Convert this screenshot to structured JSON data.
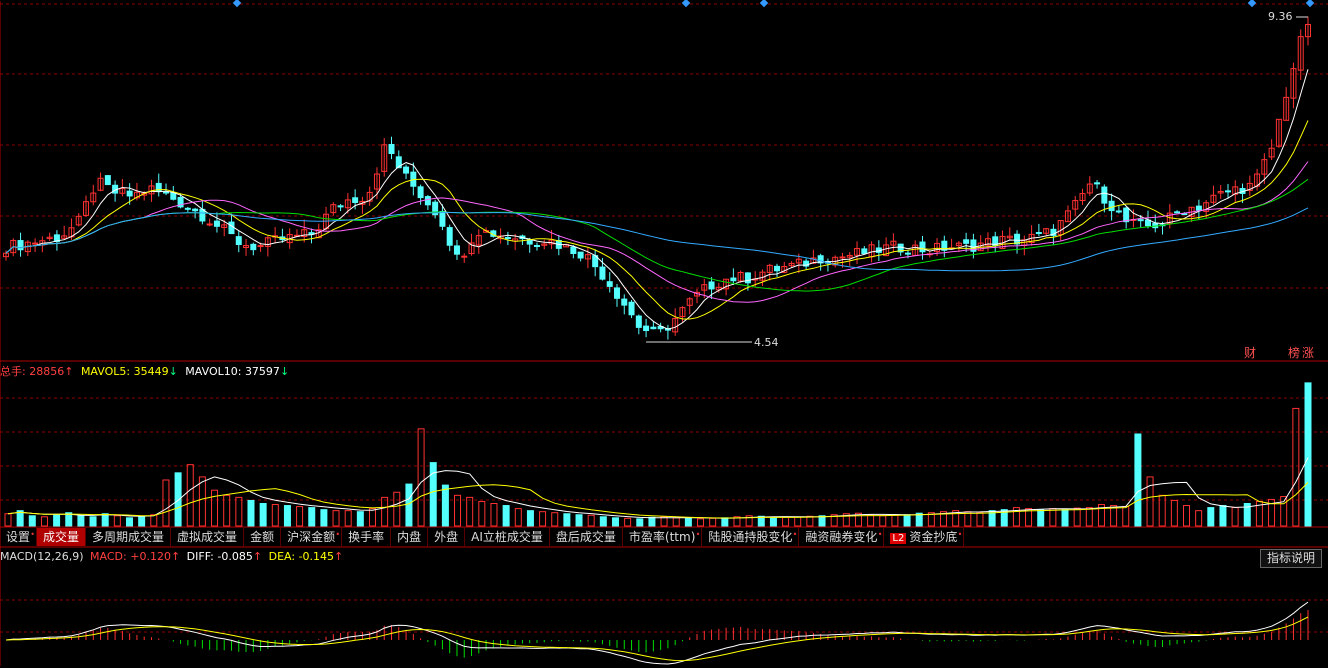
{
  "price_panel": {
    "high_label": "9.36",
    "low_label": "4.54",
    "badges": [
      "财",
      "榜",
      "涨"
    ]
  },
  "volume_panel": {
    "total_label": "总手:",
    "total_value": "28856",
    "total_arrow": "↑",
    "mavol5_label": "MAVOL5:",
    "mavol5_value": "35449",
    "mavol5_arrow": "↓",
    "mavol10_label": "MAVOL10:",
    "mavol10_value": "37597",
    "mavol10_arrow": "↓"
  },
  "tabs": [
    {
      "label": "设置",
      "dot": "•"
    },
    {
      "label": "成交量",
      "active": true
    },
    {
      "label": "多周期成交量"
    },
    {
      "label": "虚拟成交量"
    },
    {
      "label": "金额"
    },
    {
      "label": "沪深金额",
      "dot": "•"
    },
    {
      "label": "换手率"
    },
    {
      "label": "内盘"
    },
    {
      "label": "外盘"
    },
    {
      "label": "AI立桩成交量"
    },
    {
      "label": "盘后成交量"
    },
    {
      "label": "市盈率(ttm)",
      "dot": "•"
    },
    {
      "label": "陆股通持股变化",
      "dot": "•"
    },
    {
      "label": "融资融券变化",
      "dot": "•"
    },
    {
      "label": "资金抄底",
      "badge": "L2",
      "dot": "•"
    }
  ],
  "macd_panel": {
    "title": "MACD(12,26,9)",
    "macd_label": "MACD:",
    "macd_value": "+0.120",
    "macd_arrow": "↑",
    "diff_label": "DIFF:",
    "diff_value": "-0.085",
    "diff_arrow": "↑",
    "dea_label": "DEA:",
    "dea_value": "-0.145",
    "dea_arrow": "↑",
    "help_button": "指标说明"
  },
  "colors": {
    "up": "#ff3232",
    "down": "#54ffff",
    "grid": "#8b0000",
    "ma5": "#ffffff",
    "ma10": "#ffff00",
    "ma20": "#ff66ff",
    "ma30": "#00dd00",
    "ma60": "#33aaff",
    "diff": "#ffffff",
    "dea": "#ffff00",
    "macd_up": "#ff3232",
    "macd_down": "#00dd00",
    "marker": "#3399ff"
  },
  "chart_data": [
    {
      "type": "candlestick",
      "title": "",
      "ylim": [
        4.3,
        9.5
      ],
      "labeled_points": [
        {
          "label": "9.36",
          "value": 9.36
        },
        {
          "label": "4.54",
          "value": 4.54
        }
      ],
      "close_path": [
        5.95,
        6.0,
        6.05,
        6.1,
        6.3,
        6.9,
        6.75,
        6.7,
        6.8,
        6.7,
        6.55,
        6.4,
        6.2,
        6.0,
        5.95,
        6.05,
        6.1,
        6.15,
        6.5,
        6.65,
        6.7,
        7.45,
        7.0,
        6.7,
        6.4,
        5.75,
        6.2,
        6.15,
        6.1,
        6.05,
        6.05,
        5.95,
        5.85,
        5.55,
        5.2,
        4.8,
        4.65,
        4.9,
        5.2,
        5.4,
        5.5,
        5.5,
        5.6,
        5.65,
        5.7,
        5.8,
        5.8,
        5.85,
        5.9,
        5.95,
        5.95,
        5.9,
        5.95,
        5.95,
        6.0,
        6.05,
        6.05,
        6.1,
        6.2,
        6.5,
        6.9,
        6.6,
        6.3,
        6.25,
        6.3,
        6.5,
        6.55,
        6.7,
        6.8,
        6.85,
        7.4,
        8.4,
        9.3
      ]
    },
    {
      "type": "bar",
      "title": "成交量",
      "series_values_desc": "volume with MAVOL5/MAVOL10",
      "values": [
        12000,
        15000,
        10000,
        9000,
        11000,
        13000,
        10000,
        9000,
        12000,
        10000,
        8000,
        9000,
        11000,
        45000,
        52000,
        60000,
        48000,
        35000,
        30000,
        28000,
        25000,
        22000,
        21000,
        20000,
        19000,
        18000,
        16000,
        15000,
        15000,
        14000,
        17000,
        28000,
        33000,
        41000,
        95000,
        62000,
        40000,
        30000,
        28000,
        24000,
        22000,
        20000,
        17000,
        15000,
        14000,
        13000,
        12000,
        11000,
        10500,
        9000,
        8000,
        7500,
        7000,
        8500,
        9000,
        8000,
        7500,
        7000,
        7500,
        8000,
        9000,
        10000,
        9500,
        8800,
        8500,
        8800,
        9500,
        10000,
        11000,
        12000,
        12500,
        11000,
        10000,
        10500,
        11000,
        12500,
        13000,
        14000,
        15000,
        14000,
        13000,
        15000,
        16000,
        18000,
        17000,
        16000,
        17000,
        16000,
        17500,
        18000,
        21000,
        20000,
        19000,
        90000,
        48000,
        30000,
        25000,
        20000,
        15000,
        18000,
        20000,
        18000,
        22000,
        24000,
        26000,
        28800,
        115000,
        140000
      ]
    }
  ]
}
